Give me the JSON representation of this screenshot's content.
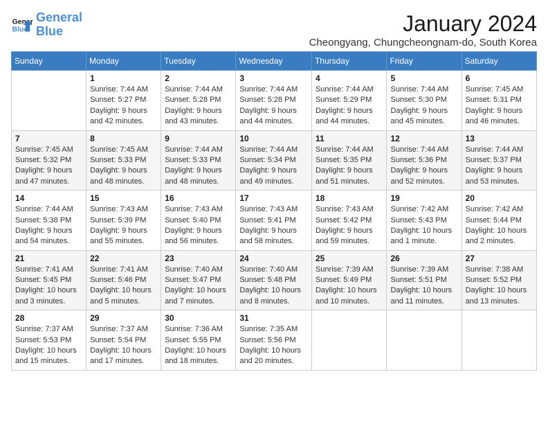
{
  "logo": {
    "line1": "General",
    "line2": "Blue"
  },
  "title": "January 2024",
  "location": "Cheongyang, Chungcheongnam-do, South Korea",
  "days_of_week": [
    "Sunday",
    "Monday",
    "Tuesday",
    "Wednesday",
    "Thursday",
    "Friday",
    "Saturday"
  ],
  "weeks": [
    [
      {
        "day": "",
        "info": ""
      },
      {
        "day": "1",
        "info": "Sunrise: 7:44 AM\nSunset: 5:27 PM\nDaylight: 9 hours\nand 42 minutes."
      },
      {
        "day": "2",
        "info": "Sunrise: 7:44 AM\nSunset: 5:28 PM\nDaylight: 9 hours\nand 43 minutes."
      },
      {
        "day": "3",
        "info": "Sunrise: 7:44 AM\nSunset: 5:28 PM\nDaylight: 9 hours\nand 44 minutes."
      },
      {
        "day": "4",
        "info": "Sunrise: 7:44 AM\nSunset: 5:29 PM\nDaylight: 9 hours\nand 44 minutes."
      },
      {
        "day": "5",
        "info": "Sunrise: 7:44 AM\nSunset: 5:30 PM\nDaylight: 9 hours\nand 45 minutes."
      },
      {
        "day": "6",
        "info": "Sunrise: 7:45 AM\nSunset: 5:31 PM\nDaylight: 9 hours\nand 46 minutes."
      }
    ],
    [
      {
        "day": "7",
        "info": "Sunrise: 7:45 AM\nSunset: 5:32 PM\nDaylight: 9 hours\nand 47 minutes."
      },
      {
        "day": "8",
        "info": "Sunrise: 7:45 AM\nSunset: 5:33 PM\nDaylight: 9 hours\nand 48 minutes."
      },
      {
        "day": "9",
        "info": "Sunrise: 7:44 AM\nSunset: 5:33 PM\nDaylight: 9 hours\nand 48 minutes."
      },
      {
        "day": "10",
        "info": "Sunrise: 7:44 AM\nSunset: 5:34 PM\nDaylight: 9 hours\nand 49 minutes."
      },
      {
        "day": "11",
        "info": "Sunrise: 7:44 AM\nSunset: 5:35 PM\nDaylight: 9 hours\nand 51 minutes."
      },
      {
        "day": "12",
        "info": "Sunrise: 7:44 AM\nSunset: 5:36 PM\nDaylight: 9 hours\nand 52 minutes."
      },
      {
        "day": "13",
        "info": "Sunrise: 7:44 AM\nSunset: 5:37 PM\nDaylight: 9 hours\nand 53 minutes."
      }
    ],
    [
      {
        "day": "14",
        "info": "Sunrise: 7:44 AM\nSunset: 5:38 PM\nDaylight: 9 hours\nand 54 minutes."
      },
      {
        "day": "15",
        "info": "Sunrise: 7:43 AM\nSunset: 5:39 PM\nDaylight: 9 hours\nand 55 minutes."
      },
      {
        "day": "16",
        "info": "Sunrise: 7:43 AM\nSunset: 5:40 PM\nDaylight: 9 hours\nand 56 minutes."
      },
      {
        "day": "17",
        "info": "Sunrise: 7:43 AM\nSunset: 5:41 PM\nDaylight: 9 hours\nand 58 minutes."
      },
      {
        "day": "18",
        "info": "Sunrise: 7:43 AM\nSunset: 5:42 PM\nDaylight: 9 hours\nand 59 minutes."
      },
      {
        "day": "19",
        "info": "Sunrise: 7:42 AM\nSunset: 5:43 PM\nDaylight: 10 hours\nand 1 minute."
      },
      {
        "day": "20",
        "info": "Sunrise: 7:42 AM\nSunset: 5:44 PM\nDaylight: 10 hours\nand 2 minutes."
      }
    ],
    [
      {
        "day": "21",
        "info": "Sunrise: 7:41 AM\nSunset: 5:45 PM\nDaylight: 10 hours\nand 3 minutes."
      },
      {
        "day": "22",
        "info": "Sunrise: 7:41 AM\nSunset: 5:46 PM\nDaylight: 10 hours\nand 5 minutes."
      },
      {
        "day": "23",
        "info": "Sunrise: 7:40 AM\nSunset: 5:47 PM\nDaylight: 10 hours\nand 7 minutes."
      },
      {
        "day": "24",
        "info": "Sunrise: 7:40 AM\nSunset: 5:48 PM\nDaylight: 10 hours\nand 8 minutes."
      },
      {
        "day": "25",
        "info": "Sunrise: 7:39 AM\nSunset: 5:49 PM\nDaylight: 10 hours\nand 10 minutes."
      },
      {
        "day": "26",
        "info": "Sunrise: 7:39 AM\nSunset: 5:51 PM\nDaylight: 10 hours\nand 11 minutes."
      },
      {
        "day": "27",
        "info": "Sunrise: 7:38 AM\nSunset: 5:52 PM\nDaylight: 10 hours\nand 13 minutes."
      }
    ],
    [
      {
        "day": "28",
        "info": "Sunrise: 7:37 AM\nSunset: 5:53 PM\nDaylight: 10 hours\nand 15 minutes."
      },
      {
        "day": "29",
        "info": "Sunrise: 7:37 AM\nSunset: 5:54 PM\nDaylight: 10 hours\nand 17 minutes."
      },
      {
        "day": "30",
        "info": "Sunrise: 7:36 AM\nSunset: 5:55 PM\nDaylight: 10 hours\nand 18 minutes."
      },
      {
        "day": "31",
        "info": "Sunrise: 7:35 AM\nSunset: 5:56 PM\nDaylight: 10 hours\nand 20 minutes."
      },
      {
        "day": "",
        "info": ""
      },
      {
        "day": "",
        "info": ""
      },
      {
        "day": "",
        "info": ""
      }
    ]
  ]
}
